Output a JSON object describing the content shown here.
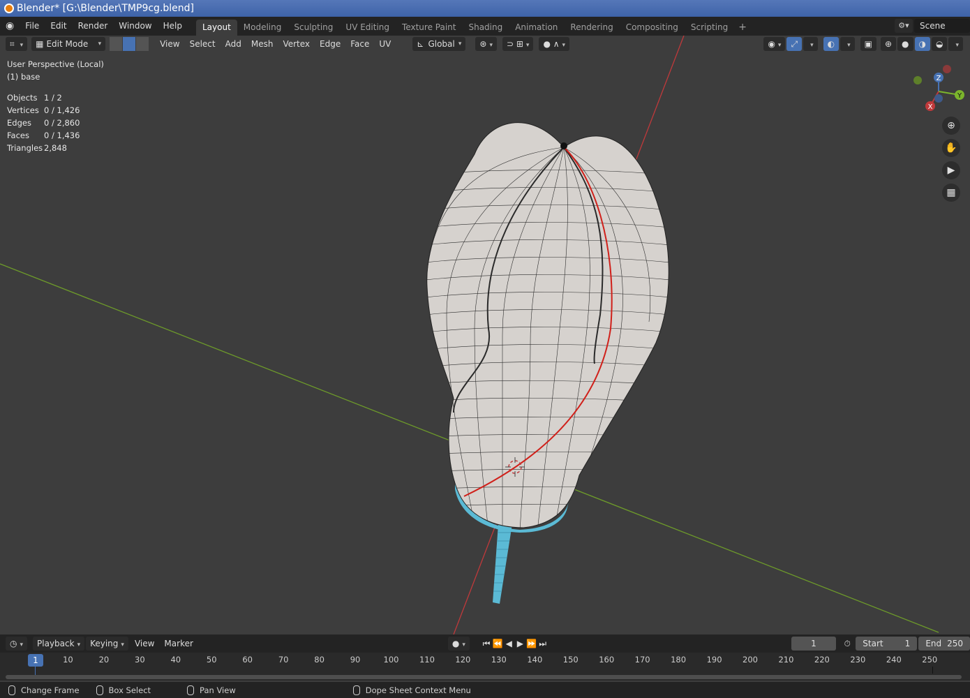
{
  "window": {
    "title": "Blender* [G:\\Blender\\TMP9cg.blend]"
  },
  "topbar": {
    "menus": [
      "File",
      "Edit",
      "Render",
      "Window",
      "Help"
    ],
    "workspaces": [
      "Layout",
      "Modeling",
      "Sculpting",
      "UV Editing",
      "Texture Paint",
      "Shading",
      "Animation",
      "Rendering",
      "Compositing",
      "Scripting"
    ],
    "add_label": "+",
    "scene": "Scene"
  },
  "viewport_header": {
    "mode": "Edit Mode",
    "menus": [
      "View",
      "Select",
      "Add",
      "Mesh",
      "Vertex",
      "Edge",
      "Face",
      "UV"
    ],
    "orientation": "Global"
  },
  "overlay": {
    "perspective": "User Perspective (Local)",
    "object": "(1) base",
    "stats": [
      {
        "label": "Objects",
        "value": "1 / 2"
      },
      {
        "label": "Vertices",
        "value": "0 / 1,426"
      },
      {
        "label": "Edges",
        "value": "0 / 2,860"
      },
      {
        "label": "Faces",
        "value": "0 / 1,436"
      },
      {
        "label": "Triangles",
        "value": "2,848"
      }
    ]
  },
  "gizmo": {
    "x": "X",
    "y": "Y",
    "z": "Z"
  },
  "timeline": {
    "menus": [
      "Playback",
      "Keying",
      "View",
      "Marker"
    ],
    "current_frame": "1",
    "start_label": "Start",
    "start": "1",
    "end_label": "End",
    "end": "250",
    "ticks": [
      "10",
      "20",
      "30",
      "40",
      "50",
      "60",
      "70",
      "80",
      "90",
      "100",
      "110",
      "120",
      "130",
      "140",
      "150",
      "160",
      "170",
      "180",
      "190",
      "200",
      "210",
      "220",
      "230",
      "240",
      "250"
    ],
    "playhead": "1"
  },
  "statusbar": {
    "items": [
      "Change Frame",
      "Box Select",
      "Pan View",
      "Dope Sheet Context Menu"
    ]
  },
  "colors": {
    "accent": "#4772b3",
    "x_axis": "#c0393b",
    "y_axis": "#6d9a2a",
    "seam": "#d0201a",
    "selection": "#5bbad5"
  }
}
